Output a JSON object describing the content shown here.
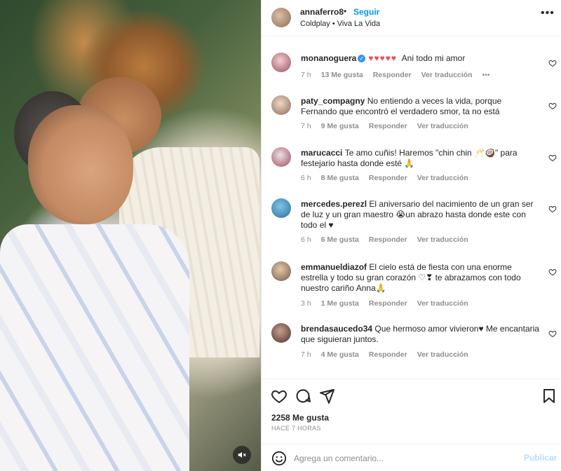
{
  "post": {
    "username": "annaferro8",
    "separator": "•",
    "follow_label": "Seguir",
    "music": "Coldplay • Viva La Vida",
    "more_label": "•••"
  },
  "comments": [
    {
      "username": "monanoguera",
      "verified": true,
      "hearts": "♥♥♥♥♥",
      "text": "Ani todo mi amor",
      "time": "7 h",
      "likes": "13 Me gusta",
      "reply": "Responder",
      "translate": "Ver traducción",
      "more": "•••"
    },
    {
      "username": "paty_compagny",
      "text": "No entiendo a veces la vida, porque Fernando que encontró el verdadero smor, ta no está",
      "time": "7 h",
      "likes": "9 Me gusta",
      "reply": "Responder",
      "translate": "Ver traducción"
    },
    {
      "username": "marucacci",
      "text": "Te amo cuñis! Haremos \"chin chin 🥂🥥\" para festejario hasta donde esté 🙏",
      "time": "6 h",
      "likes": "8 Me gusta",
      "reply": "Responder",
      "translate": "Ver traducción"
    },
    {
      "username": "mercedes.perezl",
      "text": "El aniversario del nacimiento de un gran ser de luz y un gran maestro 😭un abrazo hasta donde este con todo el ♥",
      "time": "6 h",
      "likes": "6 Me gusta",
      "reply": "Responder",
      "translate": "Ver traducción"
    },
    {
      "username": "emmanueldiazof",
      "text": "El cielo está de fiesta con una enorme estrella y todo su gran corazón ♡❣ te abrazamos con todo nuestro cariño Anna🙏",
      "time": "3 h",
      "likes": "1 Me gusta",
      "reply": "Responder",
      "translate": "Ver traducción"
    },
    {
      "username": "brendasaucedo34",
      "text": "Que hermoso amor vivieron♥ Me encantaria que siguieran juntos.",
      "time": "7 h",
      "likes": "4 Me gusta",
      "reply": "Responder",
      "translate": "Ver traducción"
    }
  ],
  "footer": {
    "likes": "2258 Me gusta",
    "posted_ago": "HACE 7 HORAS",
    "comment_placeholder": "Agrega un comentario...",
    "post_label": "Publicar"
  },
  "colors": {
    "accent_blue": "#0095f6",
    "heart_red": "#ed4956",
    "muted_text": "#8e8e8e",
    "post_disabled": "#b2dffc"
  },
  "icons": {
    "header_avatar": "avatar",
    "more": "more-horizontal-icon",
    "like": "heart-outline-icon",
    "comment": "comment-bubble-icon",
    "share": "paper-plane-icon",
    "save": "bookmark-icon",
    "emoji": "smiley-icon",
    "mute": "speaker-muted-icon"
  }
}
